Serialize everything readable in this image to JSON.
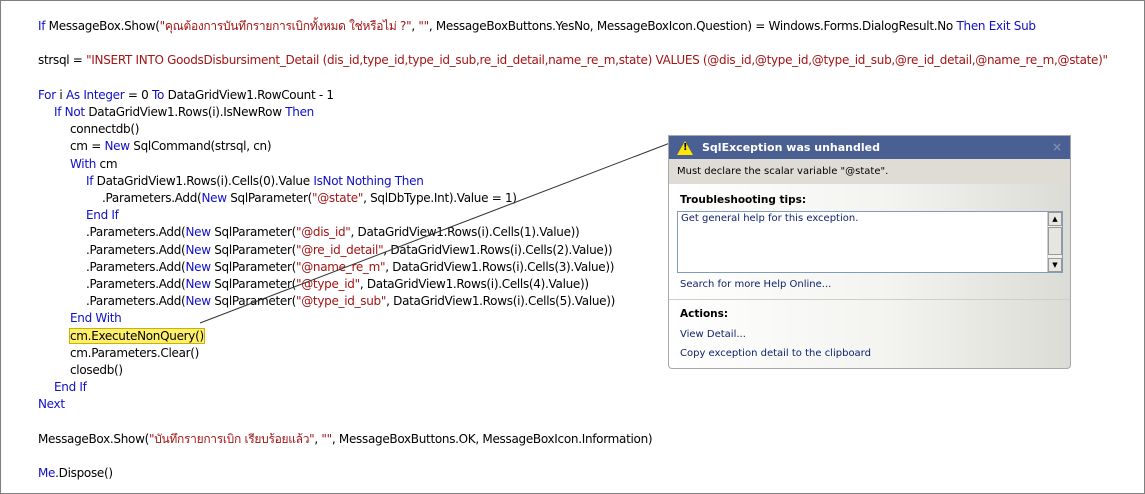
{
  "code_lines": [
    {
      "indent": 0,
      "row": 0,
      "tokens": [
        [
          "kw",
          "If"
        ],
        [
          "",
          ""
        ],
        [
          "",
          " MessageBox.Show("
        ],
        [
          "str",
          "\"คุณต้องการบันทึกรายการเบิกทั้งหมด ใช่หรือไม่ ?\""
        ],
        [
          "",
          ", "
        ],
        [
          "str",
          "\"\""
        ],
        [
          "",
          ", MessageBoxButtons.YesNo, MessageBoxIcon.Question) = Windows.Forms.DialogResult.No "
        ],
        [
          "kw",
          "Then Exit Sub"
        ]
      ]
    },
    {
      "indent": 0,
      "row": 2,
      "tokens": [
        [
          "",
          "strsql = "
        ],
        [
          "str",
          "\"INSERT INTO GoodsDisbursiment_Detail (dis_id,type_id,type_id_sub,re_id_detail,name_re_m,state) VALUES (@dis_id,@type_id,@type_id_sub,@re_id_detail,@name_re_m,@state)\""
        ]
      ]
    },
    {
      "indent": 0,
      "row": 4,
      "tokens": [
        [
          "kw",
          "For"
        ],
        [
          "",
          " i "
        ],
        [
          "kw",
          "As Integer"
        ],
        [
          "",
          " = 0 "
        ],
        [
          "kw",
          "To"
        ],
        [
          "",
          " DataGridView1.RowCount - 1"
        ]
      ]
    },
    {
      "indent": 1,
      "row": 5,
      "tokens": [
        [
          "kw",
          "If Not"
        ],
        [
          "",
          " DataGridView1.Rows(i).IsNewRow "
        ],
        [
          "kw",
          "Then"
        ]
      ]
    },
    {
      "indent": 2,
      "row": 6,
      "tokens": [
        [
          "",
          "connectdb()"
        ]
      ]
    },
    {
      "indent": 2,
      "row": 7,
      "tokens": [
        [
          "",
          "cm = "
        ],
        [
          "kw",
          "New"
        ],
        [
          "",
          " SqlCommand(strsql, cn)"
        ]
      ]
    },
    {
      "indent": 2,
      "row": 8,
      "tokens": [
        [
          "kw",
          "With"
        ],
        [
          "",
          " cm"
        ]
      ]
    },
    {
      "indent": 3,
      "row": 9,
      "tokens": [
        [
          "kw",
          "If"
        ],
        [
          "",
          " DataGridView1.Rows(i).Cells(0).Value "
        ],
        [
          "kw",
          "IsNot Nothing Then"
        ]
      ]
    },
    {
      "indent": 4,
      "row": 10,
      "tokens": [
        [
          "",
          ".Parameters.Add("
        ],
        [
          "kw",
          "New"
        ],
        [
          "",
          " SqlParameter("
        ],
        [
          "str",
          "\"@state\""
        ],
        [
          "",
          ", SqlDbType.Int).Value = 1)"
        ]
      ]
    },
    {
      "indent": 3,
      "row": 11,
      "tokens": [
        [
          "kw",
          "End If"
        ]
      ]
    },
    {
      "indent": 3,
      "row": 12,
      "tokens": [
        [
          "",
          ".Parameters.Add("
        ],
        [
          "kw",
          "New"
        ],
        [
          "",
          " SqlParameter("
        ],
        [
          "str",
          "\"@dis_id\""
        ],
        [
          "",
          ", DataGridView1.Rows(i).Cells(1).Value))"
        ]
      ]
    },
    {
      "indent": 3,
      "row": 13,
      "tokens": [
        [
          "",
          ".Parameters.Add("
        ],
        [
          "kw",
          "New"
        ],
        [
          "",
          " SqlParameter("
        ],
        [
          "str",
          "\"@re_id_detail\""
        ],
        [
          "",
          ", DataGridView1.Rows(i).Cells(2).Value))"
        ]
      ]
    },
    {
      "indent": 3,
      "row": 14,
      "tokens": [
        [
          "",
          ".Parameters.Add("
        ],
        [
          "kw",
          "New"
        ],
        [
          "",
          " SqlParameter("
        ],
        [
          "str",
          "\"@name_re_m\""
        ],
        [
          "",
          ", DataGridView1.Rows(i).Cells(3).Value))"
        ]
      ]
    },
    {
      "indent": 3,
      "row": 15,
      "tokens": [
        [
          "",
          ".Parameters.Add("
        ],
        [
          "kw",
          "New"
        ],
        [
          "",
          " SqlParameter("
        ],
        [
          "str",
          "\"@type_id\""
        ],
        [
          "",
          ", DataGridView1.Rows(i).Cells(4).Value))"
        ]
      ]
    },
    {
      "indent": 3,
      "row": 16,
      "tokens": [
        [
          "",
          ".Parameters.Add("
        ],
        [
          "kw",
          "New"
        ],
        [
          "",
          " SqlParameter("
        ],
        [
          "str",
          "\"@type_id_sub\""
        ],
        [
          "",
          ", DataGridView1.Rows(i).Cells(5).Value))"
        ]
      ]
    },
    {
      "indent": 2,
      "row": 17,
      "tokens": [
        [
          "kw",
          "End With"
        ]
      ]
    },
    {
      "indent": 2,
      "row": 18,
      "tokens": [
        [
          "hl",
          "cm.ExecuteNonQuery()"
        ]
      ]
    },
    {
      "indent": 2,
      "row": 19,
      "tokens": [
        [
          "",
          "cm.Parameters.Clear()"
        ]
      ]
    },
    {
      "indent": 2,
      "row": 20,
      "tokens": [
        [
          "",
          "closedb()"
        ]
      ]
    },
    {
      "indent": 1,
      "row": 21,
      "tokens": [
        [
          "kw",
          "End If"
        ]
      ]
    },
    {
      "indent": 0,
      "row": 22,
      "tokens": [
        [
          "kw",
          "Next"
        ]
      ]
    },
    {
      "indent": 0,
      "row": 24,
      "tokens": [
        [
          "",
          "MessageBox.Show("
        ],
        [
          "str",
          "\"บันทึกรายการเบิก เรียบร้อยแล้ว\""
        ],
        [
          "",
          ", "
        ],
        [
          "str",
          "\"\""
        ],
        [
          "",
          ", MessageBoxButtons.OK, MessageBoxIcon.Information)"
        ]
      ]
    },
    {
      "indent": 0,
      "row": 26,
      "tokens": [
        [
          "kw",
          "Me"
        ],
        [
          "",
          ".Dispose()"
        ]
      ]
    }
  ],
  "exception_helper": {
    "title": "SqlException was unhandled",
    "close": "×",
    "warning_glyph": "!",
    "message": "Must declare the scalar variable \"@state\".",
    "troubleshooting_heading": "Troubleshooting tips:",
    "tips": [
      "Get general help for this exception."
    ],
    "search_link": "Search for more Help Online...",
    "actions_heading": "Actions:",
    "actions": [
      "View Detail...",
      "Copy exception detail to the clipboard"
    ]
  },
  "colors": {
    "keyword": "#1010c8",
    "string": "#a31515",
    "title_bar": "#4a5f92",
    "highlight": "#ffef6b"
  }
}
